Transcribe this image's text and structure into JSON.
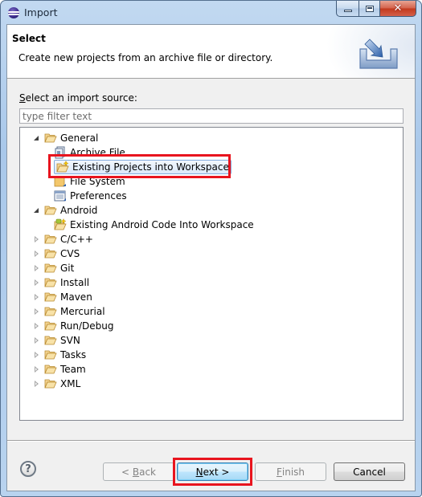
{
  "window": {
    "title": "Import",
    "controls": {
      "minimize": "minimize",
      "maximize": "maximize",
      "close": "close"
    }
  },
  "header": {
    "title": "Select",
    "description": "Create new projects from an archive file or directory."
  },
  "source": {
    "label_mnemonic": "S",
    "label_rest": "elect an import source:",
    "filter_placeholder": "type filter text",
    "filter_value": ""
  },
  "tree": {
    "items": [
      {
        "label": "General",
        "level": 0,
        "expanded": true,
        "icon": "folder-open-icon"
      },
      {
        "label": "Archive File",
        "level": 1,
        "icon": "archive-file-icon"
      },
      {
        "label": "Existing Projects into Workspace",
        "level": 1,
        "icon": "existing-projects-icon",
        "selected": true,
        "highlighted": true
      },
      {
        "label": "File System",
        "level": 1,
        "icon": "file-system-icon"
      },
      {
        "label": "Preferences",
        "level": 1,
        "icon": "preferences-icon"
      },
      {
        "label": "Android",
        "level": 0,
        "expanded": true,
        "icon": "folder-open-icon"
      },
      {
        "label": "Existing Android Code Into Workspace",
        "level": 1,
        "icon": "android-import-icon"
      },
      {
        "label": "C/C++",
        "level": 0,
        "expanded": false,
        "icon": "folder-icon"
      },
      {
        "label": "CVS",
        "level": 0,
        "expanded": false,
        "icon": "folder-icon"
      },
      {
        "label": "Git",
        "level": 0,
        "expanded": false,
        "icon": "folder-icon"
      },
      {
        "label": "Install",
        "level": 0,
        "expanded": false,
        "icon": "folder-icon"
      },
      {
        "label": "Maven",
        "level": 0,
        "expanded": false,
        "icon": "folder-icon"
      },
      {
        "label": "Mercurial",
        "level": 0,
        "expanded": false,
        "icon": "folder-icon"
      },
      {
        "label": "Run/Debug",
        "level": 0,
        "expanded": false,
        "icon": "folder-icon"
      },
      {
        "label": "SVN",
        "level": 0,
        "expanded": false,
        "icon": "folder-icon"
      },
      {
        "label": "Tasks",
        "level": 0,
        "expanded": false,
        "icon": "folder-icon"
      },
      {
        "label": "Team",
        "level": 0,
        "expanded": false,
        "icon": "folder-icon"
      },
      {
        "label": "XML",
        "level": 0,
        "expanded": false,
        "icon": "folder-icon"
      }
    ]
  },
  "buttons": {
    "help": "?",
    "back": {
      "prefix": "< ",
      "mnemonic": "B",
      "rest": "ack",
      "enabled": false
    },
    "next": {
      "mnemonic": "N",
      "rest": "ext >",
      "enabled": true,
      "default": true,
      "highlighted": true
    },
    "finish": {
      "mnemonic": "F",
      "rest": "inish",
      "enabled": false
    },
    "cancel": {
      "label": "Cancel",
      "enabled": true
    }
  },
  "colors": {
    "highlight_annotation": "#e8141e",
    "selection_border": "#84acdd",
    "folder": "#e8b04a"
  }
}
